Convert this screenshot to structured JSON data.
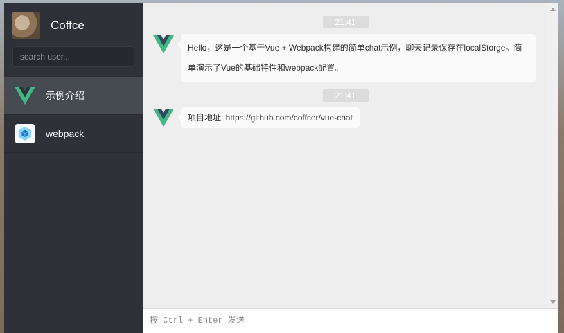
{
  "profile": {
    "name": "Coffce",
    "avatar_icon": "user-photo-avatar"
  },
  "search": {
    "placeholder": "search user..."
  },
  "users": [
    {
      "name": "示例介绍",
      "icon": "vue-logo-icon",
      "active": true
    },
    {
      "name": "webpack",
      "icon": "webpack-logo-icon",
      "active": false
    }
  ],
  "messages": [
    {
      "time": "21:41",
      "avatar_icon": "vue-logo-icon",
      "text": "Hello，这是一个基于Vue + Webpack构建的简单chat示例，聊天记录保存在localStorge。简单演示了Vue的基础特性和webpack配置。"
    },
    {
      "time": "21:41",
      "avatar_icon": "vue-logo-icon",
      "text": "项目地址: https://github.com/coffcer/vue-chat"
    }
  ],
  "composer": {
    "placeholder": "按 Ctrl + Enter 发送"
  },
  "colors": {
    "sidebar_bg": "#2e3238",
    "active_item_bg": "#464a51",
    "main_bg": "#eeeeee",
    "bubble_bg": "#fafafa",
    "vue_green": "#41b883",
    "vue_dark": "#35495e",
    "webpack_blue": "#8ed6fb"
  }
}
